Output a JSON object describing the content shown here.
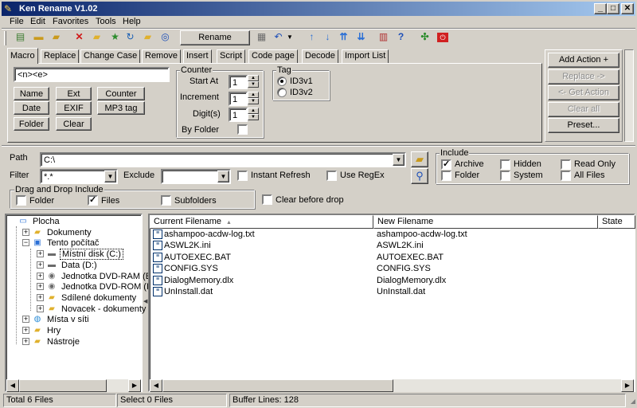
{
  "window": {
    "title": "Ken Rename V1.02"
  },
  "menu": [
    "File",
    "Edit",
    "Favorites",
    "Tools",
    "Help"
  ],
  "toolbar": {
    "rename_label": "Rename"
  },
  "tabs": [
    "Macro",
    "Replace",
    "Change Case",
    "Remove",
    "Insert",
    "Script",
    "Code page",
    "Decode",
    "Import List"
  ],
  "macro": {
    "value": "<n><e>",
    "buttons": [
      "Name",
      "Ext",
      "Counter",
      "Date",
      "EXIF",
      "MP3 tag",
      "Folder",
      "Clear"
    ]
  },
  "counter": {
    "title": "Counter",
    "start_label": "Start At",
    "start_value": "1",
    "increment_label": "Increment",
    "increment_value": "1",
    "digits_label": "Digit(s)",
    "digits_value": "1",
    "by_folder_label": "By Folder"
  },
  "tag": {
    "title": "Tag",
    "options": [
      "ID3v1",
      "ID3v2"
    ],
    "selected": "ID3v1"
  },
  "actions": [
    "Add Action +",
    "Replace ->",
    "<- Get Action",
    "Clear all",
    "Preset..."
  ],
  "path": {
    "label": "Path",
    "value": "C:\\"
  },
  "filter": {
    "label": "Filter",
    "value": "*.*",
    "exclude_label": "Exclude",
    "exclude_value": "",
    "instant_refresh": "Instant Refresh",
    "use_regex": "Use RegEx"
  },
  "include": {
    "title": "Include",
    "items": [
      {
        "label": "Archive",
        "checked": true
      },
      {
        "label": "Hidden",
        "checked": false
      },
      {
        "label": "Read Only",
        "checked": false
      },
      {
        "label": "Folder",
        "checked": false
      },
      {
        "label": "System",
        "checked": false
      },
      {
        "label": "All Files",
        "checked": false
      }
    ]
  },
  "drag_drop": {
    "title": "Drag and Drop Include",
    "items": [
      {
        "label": "Folder",
        "checked": false
      },
      {
        "label": "Files",
        "checked": true
      },
      {
        "label": "Subfolders",
        "checked": false
      }
    ],
    "clear_before_drop": "Clear before drop"
  },
  "tree": [
    {
      "label": "Plocha",
      "icon": "desktop-icon",
      "level": 0,
      "expander": ""
    },
    {
      "label": "Dokumenty",
      "icon": "folder-icon",
      "level": 1,
      "expander": "+"
    },
    {
      "label": "Tento počítač",
      "icon": "computer-icon",
      "level": 1,
      "expander": "-"
    },
    {
      "label": "Místní disk (C:)",
      "icon": "drive-icon",
      "level": 2,
      "expander": "+",
      "selected": true
    },
    {
      "label": "Data (D:)",
      "icon": "drive-icon",
      "level": 2,
      "expander": "+"
    },
    {
      "label": "Jednotka DVD-RAM (E",
      "icon": "cd-drive-icon",
      "level": 2,
      "expander": "+"
    },
    {
      "label": "Jednotka DVD-ROM (I",
      "icon": "cd-drive-icon",
      "level": 2,
      "expander": "+"
    },
    {
      "label": "Sdílené dokumenty",
      "icon": "folder-icon",
      "level": 2,
      "expander": "+"
    },
    {
      "label": "Novacek - dokumenty",
      "icon": "folder-icon",
      "level": 2,
      "expander": "+"
    },
    {
      "label": "Místa v síti",
      "icon": "network-icon",
      "level": 1,
      "expander": "+"
    },
    {
      "label": "Hry",
      "icon": "folder-icon",
      "level": 1,
      "expander": "+"
    },
    {
      "label": "Nástroje",
      "icon": "folder-icon",
      "level": 1,
      "expander": "+"
    }
  ],
  "files": {
    "columns": [
      "Current Filename",
      "New Filename",
      "State"
    ],
    "rows": [
      {
        "current": "ashampoo-acdw-log.txt",
        "new": "ashampoo-acdw-log.txt"
      },
      {
        "current": "ASWL2K.ini",
        "new": "ASWL2K.ini"
      },
      {
        "current": "AUTOEXEC.BAT",
        "new": "AUTOEXEC.BAT"
      },
      {
        "current": "CONFIG.SYS",
        "new": "CONFIG.SYS"
      },
      {
        "current": "DialogMemory.dlx",
        "new": "DialogMemory.dlx"
      },
      {
        "current": "UnInstall.dat",
        "new": "UnInstall.dat"
      }
    ]
  },
  "status": [
    "Total 6 Files",
    "Select 0 Files",
    "Buffer Lines: 128"
  ],
  "colors": {
    "titlebar_start": "#0a246a",
    "titlebar_end": "#a6caf0",
    "face": "#d4d0c8",
    "selection": "#0a246a"
  }
}
